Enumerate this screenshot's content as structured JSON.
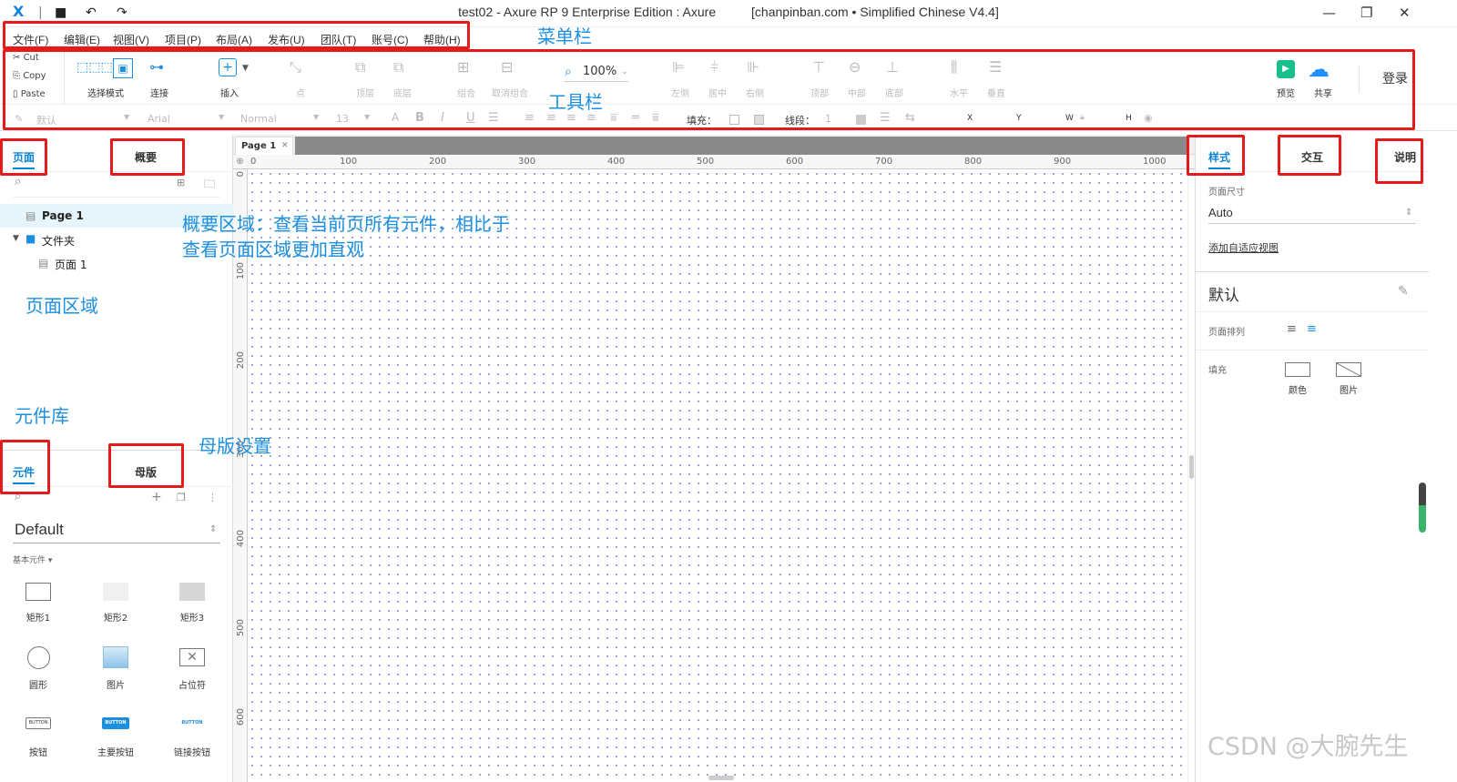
{
  "titlebar": {
    "title": "test02 - Axure RP 9 Enterprise Edition : Axure",
    "title_right": "[chanpinban.com • Simplified Chinese V4.4]"
  },
  "menu": [
    "文件(F)",
    "编辑(E)",
    "视图(V)",
    "项目(P)",
    "布局(A)",
    "发布(U)",
    "团队(T)",
    "账号(C)",
    "帮助(H)"
  ],
  "clipboard": {
    "cut": "Cut",
    "copy": "Copy",
    "paste": "Paste"
  },
  "toolbar": {
    "select_mode": "选择模式",
    "connect": "连接",
    "insert": "插入",
    "point": "点",
    "top_layer": "顶层",
    "bottom_layer": "底层",
    "group": "组合",
    "ungroup": "取消组合",
    "zoom": "100%",
    "align_left": "左侧",
    "align_center": "居中",
    "align_right": "右侧",
    "align_top": "顶部",
    "align_middle": "中部",
    "align_bottom": "底部",
    "dist_h": "水平",
    "dist_v": "垂直",
    "preview": "预览",
    "share": "共享",
    "login": "登录"
  },
  "format": {
    "style": "默认",
    "font": "Arial",
    "weight": "Normal",
    "size": "13",
    "fill_label": "填充：",
    "stroke_label": "线段：",
    "stroke_value": "1",
    "x": "X",
    "y": "Y",
    "w": "W",
    "h": "H"
  },
  "annotations": {
    "menubar": "菜单栏",
    "toolbar": "工具栏",
    "outline_line1": "概要区域：查看当前页所有元件，相比于",
    "outline_line2": "查看页面区域更加直观",
    "pages_area": "页面区域",
    "library": "元件库",
    "masters_setting": "母版设置"
  },
  "left_panel": {
    "tabs": {
      "pages": "页面",
      "outline": "概要"
    },
    "pages": [
      {
        "label": "Page 1"
      },
      {
        "label": "文件夹"
      },
      {
        "label": "页面 1"
      }
    ],
    "lib_tabs": {
      "library": "元件",
      "masters": "母版"
    },
    "library_name": "Default",
    "category": "基本元件 ▾",
    "widgets": [
      "矩形1",
      "矩形2",
      "矩形3",
      "圆形",
      "图片",
      "占位符",
      "按钮",
      "主要按钮",
      "链接按钮"
    ],
    "button_text": "BUTTON"
  },
  "canvas": {
    "tab": "Page 1",
    "ruler_h": [
      "0",
      "100",
      "200",
      "300",
      "400",
      "500",
      "600",
      "700",
      "800",
      "900",
      "1000"
    ],
    "ruler_v": [
      "0",
      "100",
      "200",
      "300",
      "400",
      "500",
      "600"
    ]
  },
  "right_panel": {
    "tabs": {
      "style": "样式",
      "interaction": "交互",
      "notes": "说明"
    },
    "page_size_label": "页面尺寸",
    "page_size_value": "Auto",
    "adaptive_link": "添加自适应视图",
    "default_style": "默认",
    "page_align_label": "页面排列",
    "fill_label": "填充",
    "fill_color": "颜色",
    "fill_image": "图片"
  },
  "watermark": "CSDN @大腕先生",
  "colors": {
    "annotation": "#1d8fe0",
    "redbox": "#e51a1a",
    "active_tab": "#0a84d6",
    "preview_green": "#17c08b",
    "share_blue": "#1e90ff"
  }
}
